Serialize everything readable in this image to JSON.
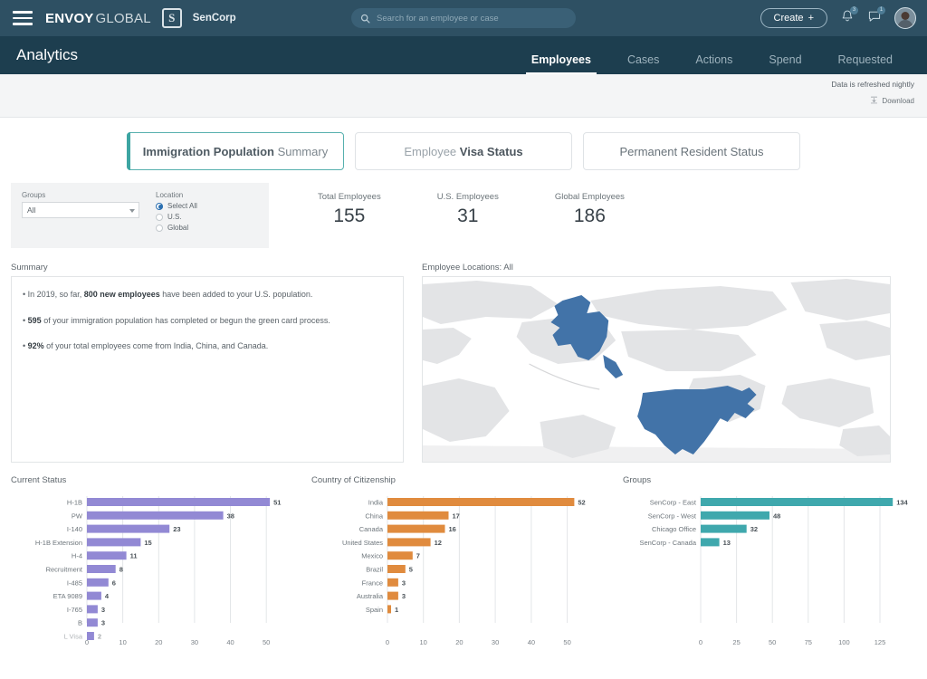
{
  "topbar": {
    "menu_icon": "hamburger-icon",
    "brand_primary": "ENVOY",
    "brand_secondary": "GLOBAL",
    "customer_logo_letter": "S",
    "customer_name": "SenCorp",
    "search_placeholder": "Search for an employee or case",
    "search_value": "",
    "create_label": "Create",
    "create_plus": "+",
    "notification_badge": "3",
    "message_badge": "1"
  },
  "subheader": {
    "page_title": "Analytics",
    "tabs": [
      {
        "label": "Employees",
        "active": true
      },
      {
        "label": "Cases",
        "active": false
      },
      {
        "label": "Actions",
        "active": false
      },
      {
        "label": "Spend",
        "active": false
      },
      {
        "label": "Requested",
        "active": false
      }
    ]
  },
  "refresh": {
    "notice": "Data is refreshed nightly",
    "download_label": "Download"
  },
  "report_tabs": [
    {
      "part_a": "Immigration Population",
      "part_b": "Summary",
      "selected": true
    },
    {
      "part_a": "Employee",
      "part_b": "Visa Status",
      "selected": false
    },
    {
      "part_a": "Permanent Resident Status",
      "part_b": "",
      "selected": false
    }
  ],
  "filters": {
    "groups_label": "Groups",
    "groups_value": "All",
    "location_label": "Location",
    "location_options": [
      {
        "label": "Select All",
        "checked": true
      },
      {
        "label": "U.S.",
        "checked": false
      },
      {
        "label": "Global",
        "checked": false
      }
    ]
  },
  "kpis": [
    {
      "label": "Total Employees",
      "value": "155"
    },
    {
      "label": "U.S. Employees",
      "value": "31"
    },
    {
      "label": "Global Employees",
      "value": "186"
    }
  ],
  "summary": {
    "title": "Summary",
    "bullets": [
      {
        "pre": "In 2019, so far, ",
        "bold": "800 new employees",
        "post": " have been added to your U.S. population."
      },
      {
        "pre": "",
        "bold": "595",
        "post": " of your immigration population has completed or begun the green card process."
      },
      {
        "pre": "",
        "bold": "92%",
        "post": " of your total employees come from India, China, and Canada."
      }
    ]
  },
  "map": {
    "title": "Employee Locations: All",
    "highlight_color": "#4273a8",
    "land_color": "#e3e4e6",
    "highlighted_regions": [
      "United States",
      "Alaska"
    ]
  },
  "chart_data": [
    {
      "type": "bar",
      "orientation": "horizontal",
      "title": "Current Status",
      "color": "#9289d4",
      "categories": [
        "H-1B",
        "PW",
        "I-140",
        "H-1B Extension",
        "H-4",
        "Recruitment",
        "I-485",
        "ETA 9089",
        "I-765",
        "B",
        "L Visa"
      ],
      "values": [
        51,
        38,
        23,
        15,
        11,
        8,
        6,
        4,
        3,
        3,
        2
      ],
      "xlabel": "",
      "ylabel": "",
      "xticks": [
        0,
        10,
        20,
        30,
        40,
        50
      ],
      "xlim": [
        0,
        55
      ],
      "grid": true,
      "clipped_last_row": true
    },
    {
      "type": "bar",
      "orientation": "horizontal",
      "title": "Country of Citizenship",
      "color": "#e08b3e",
      "categories": [
        "India",
        "China",
        "Canada",
        "United States",
        "Mexico",
        "Brazil",
        "France",
        "Australia",
        "Spain"
      ],
      "values": [
        52,
        17,
        16,
        12,
        7,
        5,
        3,
        3,
        1
      ],
      "xlabel": "",
      "ylabel": "",
      "xticks": [
        0,
        10,
        20,
        30,
        40,
        50
      ],
      "xlim": [
        0,
        56
      ],
      "grid": true
    },
    {
      "type": "bar",
      "orientation": "horizontal",
      "title": "Groups",
      "color": "#3fa8ad",
      "categories": [
        "SenCorp - East",
        "SenCorp - West",
        "Chicago Office",
        "SenCorp - Canada"
      ],
      "values": [
        134,
        48,
        32,
        13
      ],
      "xlabel": "",
      "ylabel": "",
      "xticks": [
        0,
        25,
        50,
        75,
        100,
        125
      ],
      "xlim": [
        0,
        140
      ],
      "grid": true
    }
  ],
  "colors": {
    "topbar": "#2e5063",
    "subheader": "#1d3e4f",
    "accent_teal": "#3da5a2",
    "purple": "#9289d4",
    "orange": "#e08b3e",
    "teal": "#3fa8ad",
    "map_blue": "#4273a8"
  }
}
